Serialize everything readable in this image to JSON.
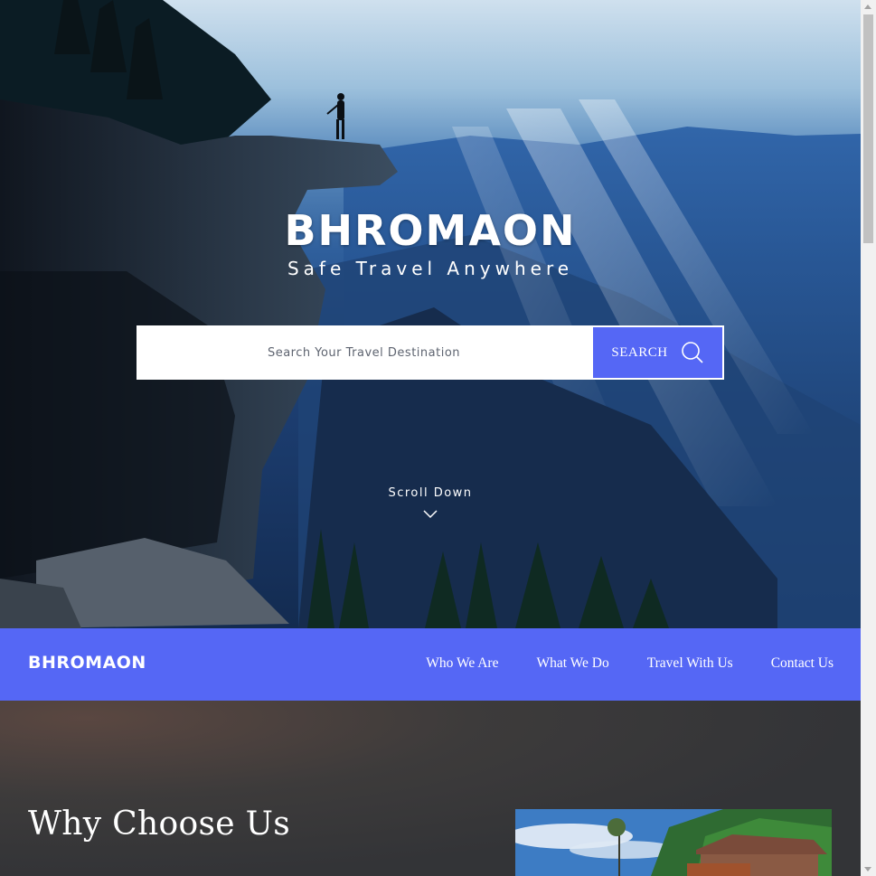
{
  "hero": {
    "brand": "BHROMAON",
    "tagline": "Safe Travel Anywhere",
    "search": {
      "placeholder": "Search Your Travel Destination",
      "button_label": "SEARCH",
      "button_icon": "search-icon"
    },
    "scroll_label": "Scroll Down",
    "scroll_icon": "chevron-down-icon"
  },
  "navbar": {
    "brand": "BHROMAON",
    "links": [
      "Who We Are",
      "What We Do",
      "Travel With Us",
      "Contact Us"
    ]
  },
  "why": {
    "heading": "Why Choose Us"
  },
  "colors": {
    "accent": "#5567f5",
    "text_light": "#ffffff",
    "section_bg": "#333437"
  }
}
